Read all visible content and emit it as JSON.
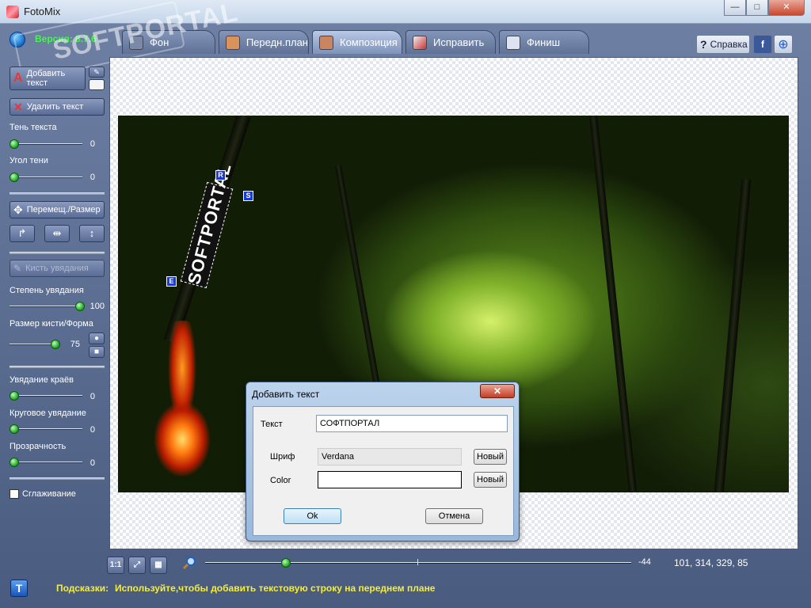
{
  "window": {
    "title": "FotoMix",
    "minimize": "—",
    "maximize": "□",
    "close": "✕"
  },
  "header": {
    "version": "Версия: 8.7.6",
    "watermark": "SOFTPORTAL",
    "tabs": [
      {
        "label": "Фон",
        "icon": "background-icon"
      },
      {
        "label": "Передн.план",
        "icon": "foreground-icon"
      },
      {
        "label": "Композиция",
        "icon": "composition-icon"
      },
      {
        "label": "Исправить",
        "icon": "brush-icon"
      },
      {
        "label": "Финиш",
        "icon": "finish-icon"
      }
    ],
    "help_label": "Справка",
    "facebook_icon": "f",
    "globe_icon": "⊕"
  },
  "left_panel": {
    "add_text": "Добавить текст",
    "delete_text": "Удалить текст",
    "text_shadow_label": "Тень текста",
    "text_shadow_value": "0",
    "shadow_angle_label": "Угол тени",
    "shadow_angle_value": "0",
    "move_resize": "Перемещ./Размер",
    "fade_brush": "Кисть увядания",
    "fade_degree_label": "Степень увядания",
    "fade_degree_value": "100",
    "brush_size_label": "Размер кисти/Форма",
    "brush_size_value": "75",
    "edge_fade_label": "Увядание краёв",
    "edge_fade_value": "0",
    "radial_fade_label": "Круговое увядание",
    "radial_fade_value": "0",
    "transparency_label": "Прозрачность",
    "transparency_value": "0",
    "smoothing_label": "Сглаживание"
  },
  "canvas": {
    "text_object": "SOFTPORTAL",
    "handles": {
      "r": "R",
      "s": "S",
      "e": "E"
    }
  },
  "dialog": {
    "title": "Добавить текст",
    "close": "✕",
    "text_label": "Текст",
    "text_value": "СОФТПОРТАЛ",
    "font_label": "Шриф",
    "font_value": "Verdana",
    "color_label": "Color",
    "new_label": "Новый",
    "ok_label": "Ok",
    "cancel_label": "Отмена"
  },
  "bottom": {
    "btn_1to1": "1:1",
    "btn_fit": "⤢",
    "btn_grid": "▦",
    "zoom_level": 0.19,
    "zoom_value": "-44",
    "coords": "101, 314, 329, 85",
    "hint_key": "Подсказки:",
    "hint_value": "Используйте,чтобы добавить текстовую строку на переднем плане",
    "text_tool": "T"
  }
}
